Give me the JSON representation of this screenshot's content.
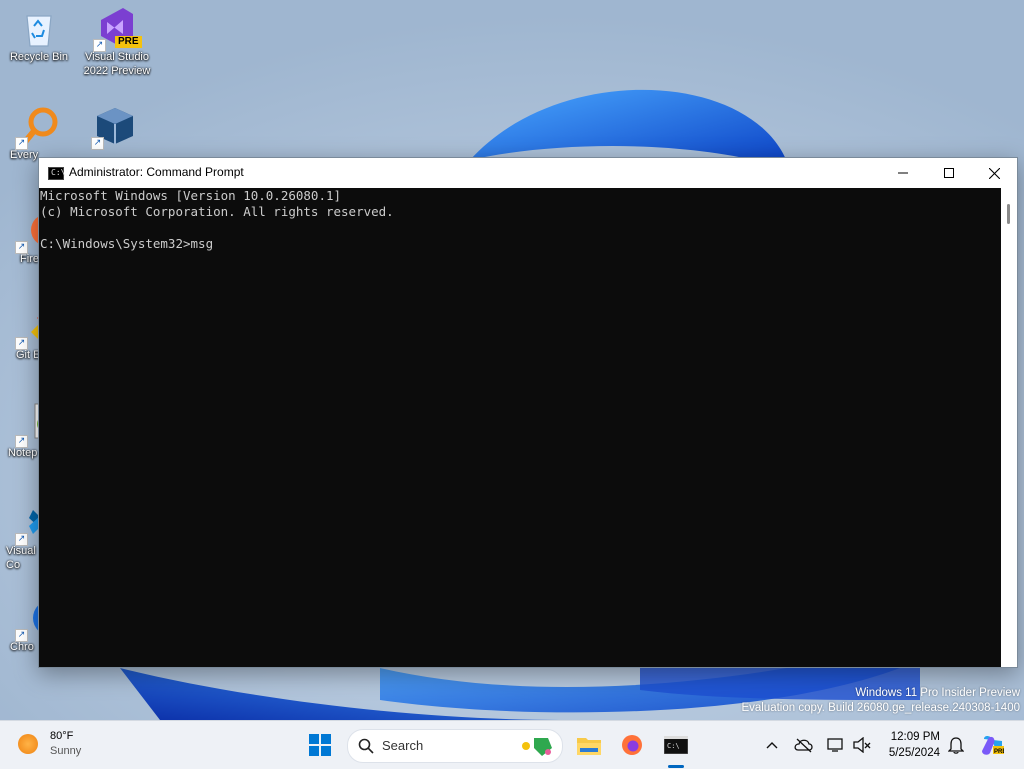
{
  "desktop": {
    "icons": [
      {
        "label": "Recycle Bin",
        "icon": "recycle-bin-icon"
      },
      {
        "label": "Visual Studio 2022 Preview",
        "badge": "PRE",
        "icon": "visual-studio-icon"
      },
      {
        "label": "Every",
        "icon": "everything-search-icon"
      },
      {
        "label": "",
        "icon": "virtualbox-icon"
      },
      {
        "label": "Fire",
        "icon": "firefox-icon"
      },
      {
        "label": "Git E",
        "icon": "git-extensions-icon"
      },
      {
        "label": "Notep",
        "icon": "notepad-plus-plus-icon"
      },
      {
        "label": "Visual\nCo",
        "icon": "vscode-icon"
      },
      {
        "label": "Chro",
        "icon": "chrome-icon"
      }
    ]
  },
  "window": {
    "title": "Administrator: Command Prompt",
    "console_lines": [
      "Microsoft Windows [Version 10.0.26080.1]",
      "(c) Microsoft Corporation. All rights reserved.",
      "",
      "C:\\Windows\\System32>msg"
    ]
  },
  "watermark": {
    "line1": "Windows 11 Pro Insider Preview",
    "line2": "Evaluation copy. Build 26080.ge_release.240308-1400"
  },
  "taskbar": {
    "weather": {
      "temp": "80°F",
      "condition": "Sunny"
    },
    "search_label": "Search",
    "clock": {
      "time": "12:09 PM",
      "date": "5/25/2024"
    }
  }
}
